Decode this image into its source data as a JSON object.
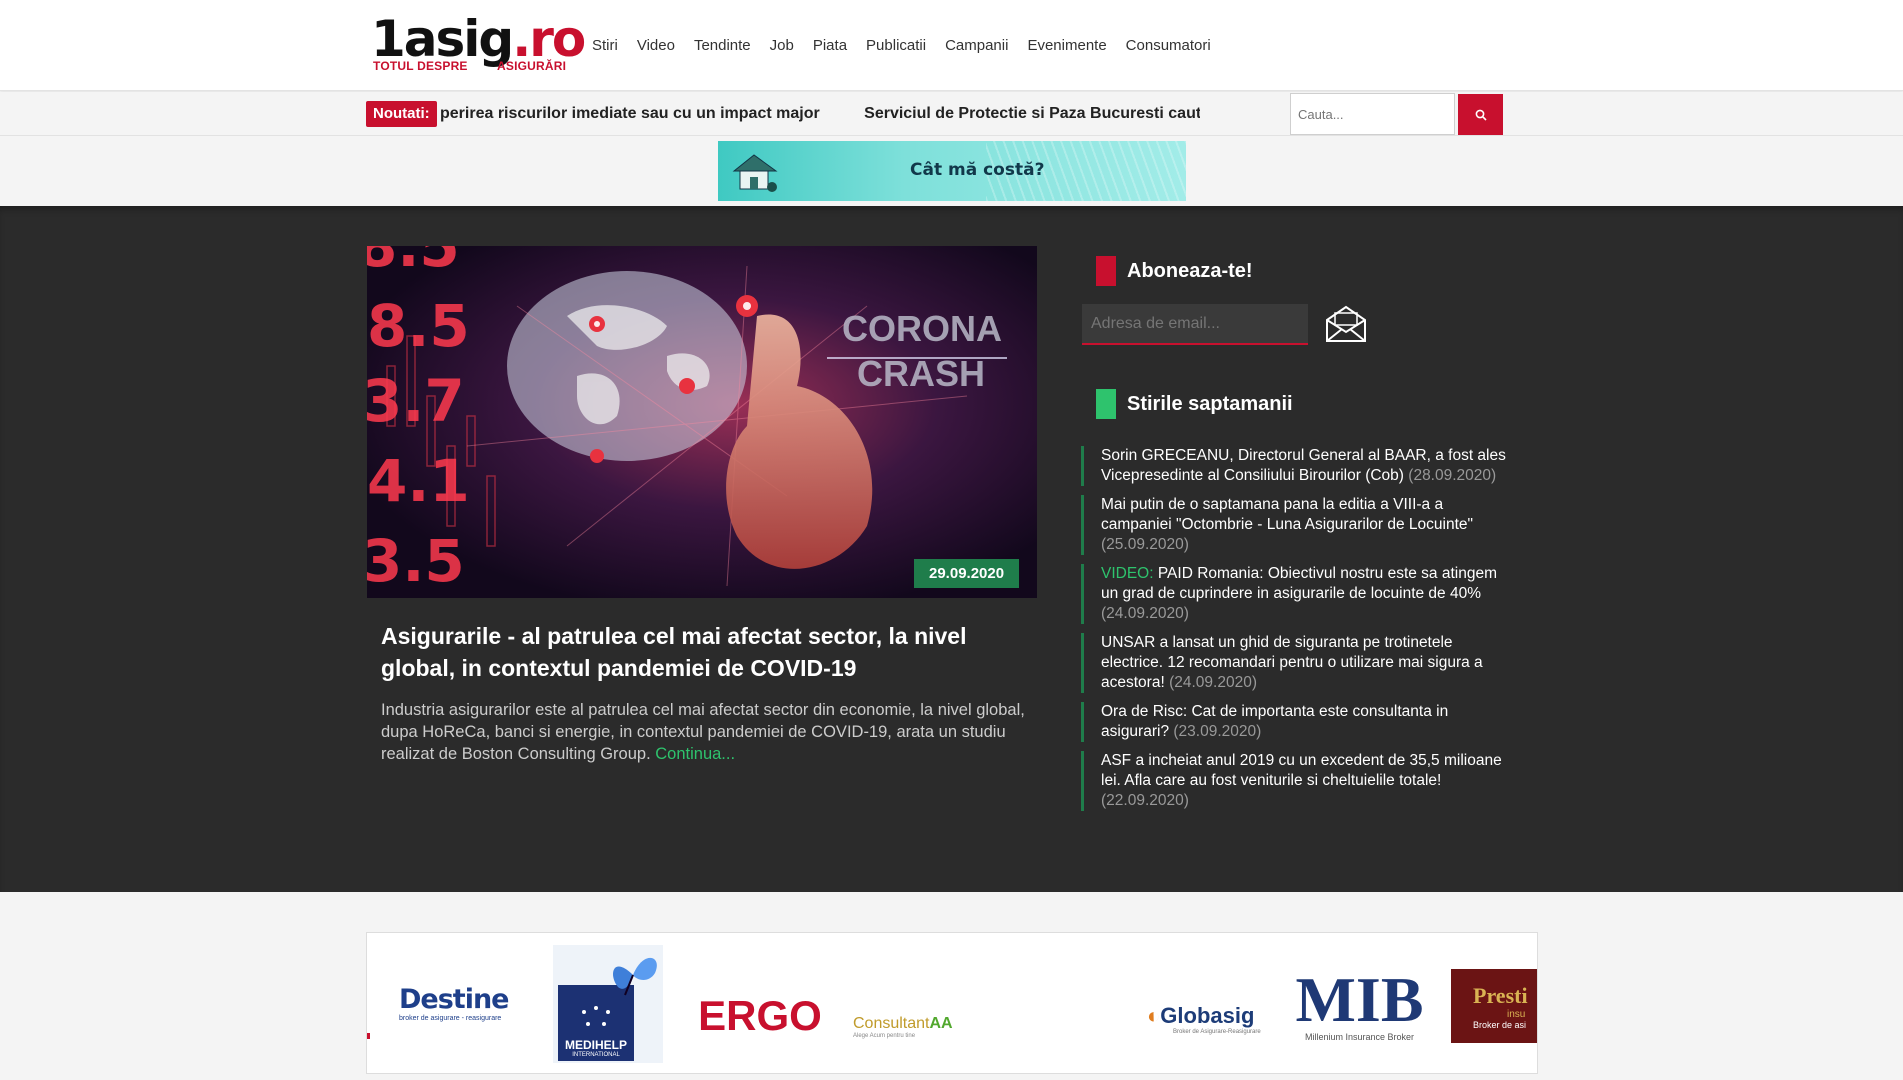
{
  "logo": {
    "main": "1asig",
    "dot": ".ro",
    "sub_left": "TOTUL DESPRE",
    "sub_right": "ASIGURĂRI"
  },
  "nav": [
    "Stiri",
    "Video",
    "Tendinte",
    "Job",
    "Piata",
    "Publicatii",
    "Campanii",
    "Evenimente",
    "Consumatori"
  ],
  "ticker": {
    "label": "Noutati:",
    "items": [
      "perirea riscurilor imediate sau cu un impact major",
      "Serviciul de Protectie si Paza Bucuresti cauta as"
    ]
  },
  "search": {
    "placeholder": "Cauta..."
  },
  "banner": {
    "text": "Cât mă costă?"
  },
  "featured": {
    "image_text_1": "CORONA",
    "image_text_2": "CRASH",
    "date": "29.09.2020",
    "title": "Asigurarile - al patrulea cel mai afectat sector, la nivel global, in contextul pandemiei de COVID-19",
    "description": "Industria asigurarilor este al patrulea cel mai afectat sector din economie, la nivel global, dupa HoReCa, banci si energie, in contextul pandemiei de COVID-19, arata un studiu realizat de Boston Consulting Group.",
    "more": "Continua..."
  },
  "subscribe": {
    "heading": "Aboneaza-te!",
    "placeholder": "Adresa de email..."
  },
  "week": {
    "heading": "Stirile saptamanii",
    "items": [
      {
        "prefix": "",
        "title": "Sorin GRECEANU, Directorul General al BAAR, a fost ales Vicepresedinte al Consiliului Birourilor (Cob)",
        "date": "(28.09.2020)"
      },
      {
        "prefix": "",
        "title": "Mai putin de o saptamana pana la editia a VIII-a a campaniei \"Octombrie - Luna Asigurarilor de Locuinte\"",
        "date": "(25.09.2020)"
      },
      {
        "prefix": "VIDEO: ",
        "title": "PAID Romania: Obiectivul nostru este sa atingem un grad de cuprindere in asigurarile de locuinte de 40%",
        "date": "(24.09.2020)"
      },
      {
        "prefix": "",
        "title": "UNSAR a lansat un ghid de siguranta pe trotinetele electrice. 12 recomandari pentru o utilizare mai sigura a acestora!",
        "date": "(24.09.2020)"
      },
      {
        "prefix": "",
        "title": "Ora de Risc: Cat de importanta este consultanta in asigurari?",
        "date": "(23.09.2020)"
      },
      {
        "prefix": "",
        "title": "ASF a incheiat anul 2019 cu un excedent de 35,5 milioane lei. Afla care au fost veniturile si cheltuielile totale!",
        "date": "(22.09.2020)"
      }
    ]
  },
  "partners": {
    "destine": "Destine",
    "destine_sub": "broker de asigurare - reasigurare",
    "medihelp": "MEDIHELP",
    "medihelp_sub": "INTERNATIONAL",
    "ergo": "ERGO",
    "consultant": "Consultant",
    "consultant_aa": "AA",
    "consultant_sub": "Alege Acum pentru tine",
    "globasig": "Globasig",
    "globasig_sub": "Broker de Asigurare-Reasigurare",
    "mib": "MIB",
    "mib_sub": "Millenium Insurance Broker",
    "prestige": "Presti",
    "prestige_mid": "insu",
    "prestige_sub": "Broker de asi"
  },
  "colors": {
    "brand_red": "#c8102e",
    "accent_green": "#1f7d4b",
    "dark_bg": "#2b2b2b"
  }
}
